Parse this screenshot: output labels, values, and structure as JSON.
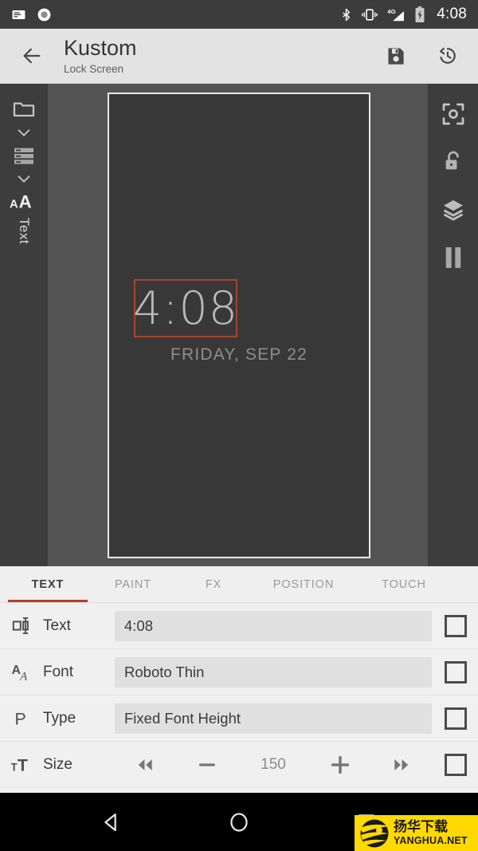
{
  "statusbar": {
    "left_icons": [
      "news-icon",
      "record-circle-icon"
    ],
    "right_icons": [
      "bluetooth-icon",
      "vibrate-icon",
      "signal-4g-icon",
      "battery-charging-icon"
    ],
    "network_label": "4G",
    "clock": "4:08"
  },
  "appbar": {
    "back_icon": "arrow-back-icon",
    "title": "Kustom",
    "subtitle": "Lock Screen",
    "save_icon": "save-icon",
    "history_icon": "history-icon"
  },
  "left_rail": {
    "items": [
      {
        "icon": "folder-icon",
        "name": "preset-folder"
      },
      {
        "icon": "chevron-down-icon",
        "name": "folder-expand"
      },
      {
        "icon": "layers-list-icon",
        "name": "layer-list"
      },
      {
        "icon": "chevron-down-icon",
        "name": "layer-expand"
      },
      {
        "icon": "font-size-icon",
        "name": "text-module"
      }
    ],
    "module_label": "Text"
  },
  "right_rail": {
    "items": [
      {
        "icon": "crop-focus-icon",
        "name": "screenshot"
      },
      {
        "icon": "unlock-icon",
        "name": "lock-toggle"
      },
      {
        "icon": "layers-icon",
        "name": "layers"
      },
      {
        "icon": "pause-icon",
        "name": "pause-preview"
      }
    ]
  },
  "preview": {
    "clock_time": "4:08",
    "clock_date": "FRIDAY, SEP 22",
    "selection_color": "#a8432a",
    "canvas_bg": "#383838",
    "stage_bg": "#545454"
  },
  "tabs": {
    "accent": "#b2441f",
    "items": [
      {
        "label": "TEXT",
        "active": true
      },
      {
        "label": "PAINT",
        "active": false
      },
      {
        "label": "FX",
        "active": false
      },
      {
        "label": "POSITION",
        "active": false
      },
      {
        "label": "TOUCH",
        "active": false
      }
    ]
  },
  "settings": {
    "rows": [
      {
        "icon": "text-width-icon",
        "label": "Text",
        "value": "4:08",
        "type": "field"
      },
      {
        "icon": "font-aa-icon",
        "label": "Font",
        "value": "Roboto Thin",
        "type": "field"
      },
      {
        "icon": "paragraph-icon",
        "label": "Type",
        "value": "Fixed Font Height",
        "type": "field"
      },
      {
        "icon": "text-size-icon",
        "label": "Size",
        "value": "150",
        "type": "stepper"
      }
    ],
    "stepper_controls": {
      "fast_rewind": "fast-rewind-icon",
      "decrement": "minus-icon",
      "increment": "plus-icon",
      "fast_forward": "fast-forward-icon"
    }
  },
  "navbar": {
    "back": "nav-back-triangle-icon",
    "home": "nav-home-circle-icon",
    "recents": "nav-recents-square-icon"
  },
  "watermark": {
    "cn": "扬华下载",
    "en": "YANGHUA.NET",
    "bg": "#ffd900"
  }
}
